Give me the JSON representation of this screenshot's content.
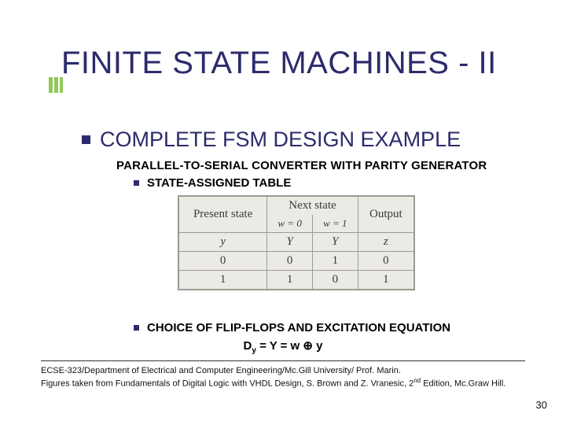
{
  "title": "FINITE STATE MACHINES - II",
  "subtitle": "COMPLETE FSM DESIGN EXAMPLE",
  "line_parallel": "PARALLEL-TO-SERIAL CONVERTER WITH PARITY GENERATOR",
  "bullet_state_table": "STATE-ASSIGNED  TABLE",
  "bullet_choice": "CHOICE OF FLIP-FLOPS AND EXCITATION EQUATION",
  "equation": {
    "lhs_base": "D",
    "lhs_sub": "y",
    "mid": " = Y = w ",
    "op": "⊕",
    "rhs": " y"
  },
  "table": {
    "hdr_present": "Present state",
    "hdr_next": "Next state",
    "hdr_output": "Output",
    "hdr_w0": "w = 0",
    "hdr_w1": "w = 1",
    "sym_y_lower": "y",
    "sym_Y": "Y",
    "sym_z": "z",
    "rows": [
      {
        "y": "0",
        "Y_w0": "0",
        "Y_w1": "1",
        "z": "0"
      },
      {
        "y": "1",
        "Y_w0": "1",
        "Y_w1": "0",
        "z": "1"
      }
    ]
  },
  "footer": {
    "line1": "ECSE-323/Department of Electrical and Computer Engineering/Mc.Gill University/ Prof. Marin.",
    "line2_a": "Figures taken from Fundamentals of Digital Logic with VHDL Design, S. Brown and Z. Vranesic, 2",
    "line2_sup": "nd",
    "line2_b": " Edition, Mc.Graw Hill."
  },
  "page_number": "30"
}
